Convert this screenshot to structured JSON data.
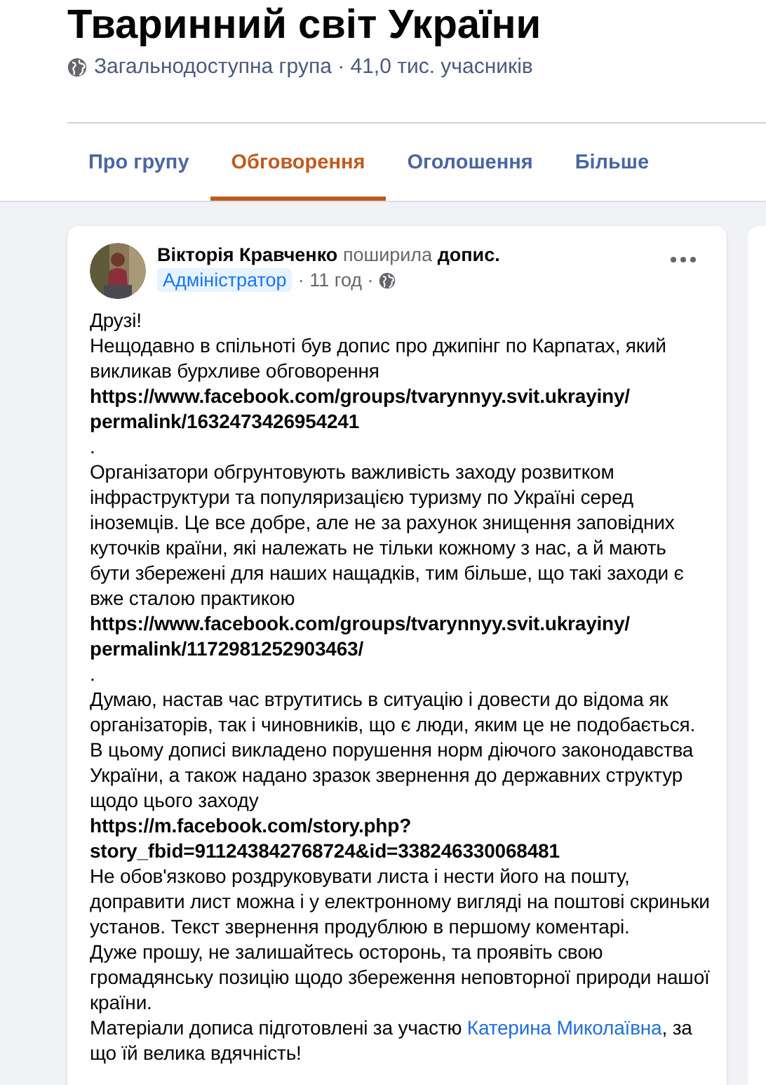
{
  "group": {
    "title": "Тваринний світ України",
    "info": "Загальнодоступна група · 41,0 тис. учасників"
  },
  "tabs": [
    {
      "label": "Про групу",
      "selected": false
    },
    {
      "label": "Обговорення",
      "selected": true
    },
    {
      "label": "Оголошення",
      "selected": false
    },
    {
      "label": "Більше",
      "selected": false
    }
  ],
  "post": {
    "author": "Вікторія Кравченко",
    "action": "поширила",
    "object": "допис.",
    "badge": "Адміністратор",
    "time": "· 11 год ·",
    "body": [
      {
        "kind": "text",
        "text": "Друзі!"
      },
      {
        "kind": "text",
        "text": "Нещодавно в спільноті був допис про джипінг по Карпатах, який викликав бурхливе обговорення"
      },
      {
        "kind": "url",
        "text": "https://www.facebook.com/groups/tvarynnyy.svit.ukrayiny/permalink/1632473426954241"
      },
      {
        "kind": "text",
        "text": "."
      },
      {
        "kind": "text",
        "text": "Організатори обгрунтовують важливість заходу розвитком інфраструктури та популяризацією туризму по Україні серед іноземців. Це все добре, але не за рахунок знищення заповідних куточків країни, які належать не тільки кожному з нас, а й мають бути збережені для наших нащадків, тим більше, що такі заходи є вже сталою практикою"
      },
      {
        "kind": "url",
        "text": "https://www.facebook.com/groups/tvarynnyy.svit.ukrayiny/permalink/1172981252903463/"
      },
      {
        "kind": "text",
        "text": "."
      },
      {
        "kind": "text",
        "text": "Думаю, настав час втрутитись в ситуацію і довести до відома як організаторів, так і чиновників, що є люди, яким це не подобається."
      },
      {
        "kind": "text",
        "text": "В цьому дописі викладено порушення норм діючого законодавства України, а також надано зразок звернення до державних структур щодо цього заходу"
      },
      {
        "kind": "url",
        "text": "https://m.facebook.com/story.php?story_fbid=911243842768724&id=338246330068481"
      },
      {
        "kind": "text",
        "text": "Не обов'язково роздруковувати листа і нести його на пошту, доправити лист можна і у електронному вигляді на поштові скриньки установ. Текст звернення продублюю в першому коментарі."
      },
      {
        "kind": "text",
        "text": "Дуже прошу, не залишайтесь осторонь, та проявіть свою громадянську позицію щодо збереження неповторної природи нашої країни."
      },
      {
        "kind": "mention",
        "before": "Матеріали дописа підготовлені за участю",
        "link": "Катерина Миколаївна",
        "after": ", за що їй велика вдячність!"
      }
    ]
  }
}
